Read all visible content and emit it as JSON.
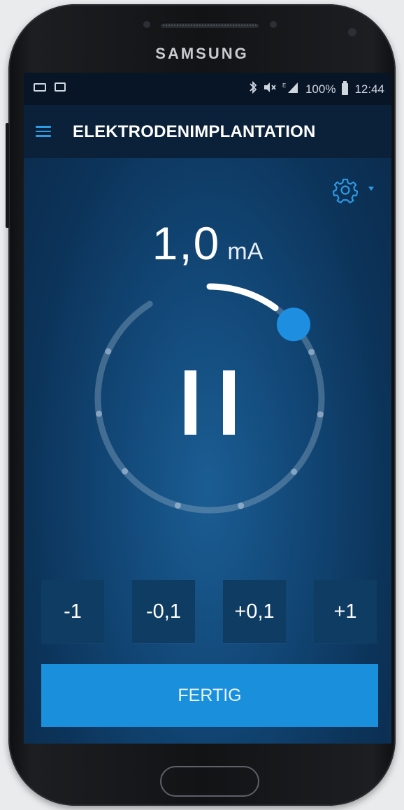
{
  "device": {
    "brand": "SAMSUNG"
  },
  "status_bar": {
    "left_icons": [
      "screen-mirror-icon",
      "gallery-icon"
    ],
    "right_icons": [
      "bluetooth-icon",
      "mute-icon",
      "signal-icon"
    ],
    "battery": "100%",
    "time": "12:44"
  },
  "app_bar": {
    "menu_icon": "hamburger-menu-icon",
    "title": "ELEKTRODENIMPLANTATION"
  },
  "settings": {
    "icon": "gear-icon",
    "dropdown": "caret-down-icon"
  },
  "readout": {
    "value": "1,0",
    "unit": "mA"
  },
  "dial": {
    "level_fraction": 0.06,
    "state": "paused",
    "knob_color": "#1e8fe0"
  },
  "steps": [
    {
      "label": "-1"
    },
    {
      "label": "-0,1"
    },
    {
      "label": "+0,1"
    },
    {
      "label": "+1"
    }
  ],
  "done_button": {
    "label": "FERTIG"
  },
  "colors": {
    "accent": "#1a8fdc",
    "background": "#0c3359",
    "button_bg": "#0f3c63"
  }
}
